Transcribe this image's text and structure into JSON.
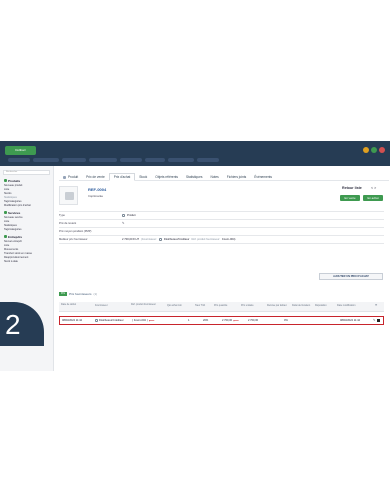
{
  "app": {
    "logo_label": "Dolibarr",
    "window_dots": [
      "#e0a020",
      "#3e9a50",
      "#d25050"
    ]
  },
  "sidebar": {
    "search_placeholder": "Rechercher",
    "sections": [
      {
        "title": "Produits",
        "items": [
          {
            "label": "Nouveau produit",
            "muted": false
          },
          {
            "label": "Liste",
            "muted": false
          },
          {
            "label": "Stocks",
            "muted": false
          },
          {
            "label": "Statistiques",
            "muted": true
          },
          {
            "label": "Tags/catégories",
            "muted": false
          },
          {
            "label": "Modification prix d'achat",
            "muted": false
          }
        ]
      },
      {
        "title": "Services",
        "items": [
          {
            "label": "Nouveau service",
            "muted": false
          },
          {
            "label": "Liste",
            "muted": false
          },
          {
            "label": "Statistiques",
            "muted": false
          },
          {
            "label": "Tags/catégories",
            "muted": false
          }
        ]
      },
      {
        "title": "Entrepôts",
        "items": [
          {
            "label": "Nouvel entrepôt",
            "muted": false
          },
          {
            "label": "Liste",
            "muted": false
          },
          {
            "label": "Mouvements",
            "muted": false
          },
          {
            "label": "Transfert stock en masse",
            "muted": false
          },
          {
            "label": "Réapprovisionnement",
            "muted": false
          },
          {
            "label": "Stock à date",
            "muted": false
          }
        ]
      }
    ]
  },
  "tabs": [
    "Produit",
    "Prix de vente",
    "Prix d'achat",
    "Stock",
    "Objets référents",
    "Statistiques",
    "Notes",
    "Fichiers joints",
    "Événements"
  ],
  "active_tab_index": 2,
  "product": {
    "ref": "REF-0004",
    "name": "Imprimante",
    "back_label": "Retour liste",
    "back_arrows": "< >",
    "badge_sale": "En vente",
    "badge_purchase": "En achat"
  },
  "fields": {
    "type_label": "Type",
    "type_value": "Produit",
    "sale_price_label": "Prix de revient",
    "pmp_label": "Prix moyen pondéré (PMP)",
    "best_price_label": "Meilleur prix fournisseur",
    "best_price_value": "2 700,00 € HT",
    "best_price_supplier_prefix": "(Fournisseur:",
    "best_price_supplier": "Distributeur/Créditeur",
    "best_price_ref_prefix": "Réf. produit fournisseur:",
    "best_price_ref": "Fourn-004)"
  },
  "actions": {
    "add_purchase_price": "AJOUTER UN PRIX D'ACHAT"
  },
  "supplier_prices": {
    "badge": "Prix",
    "title": "Prix fournisseurs",
    "count": "(1)",
    "columns": [
      "Date de début",
      "Fournisseur",
      "Réf. produit fournisseur",
      "Qté achat min",
      "Taux TVA",
      "Prix quantité",
      "Prix unitaire",
      "Remise par défaut",
      "Délai de livraison",
      "Réputation",
      "Date modification"
    ],
    "rows": [
      {
        "date": "08/03/2024 11:44",
        "supplier": "Distributeur/Créditeur",
        "supplier_ref": "Fourn-004",
        "qty": "1",
        "vat": "20%",
        "price_qty": "2 700,00",
        "unit_price": "2 700,00",
        "discount": "0%",
        "delay": "",
        "reputation": "",
        "modified": "08/03/2024 11:44"
      }
    ]
  },
  "step_number": "2"
}
